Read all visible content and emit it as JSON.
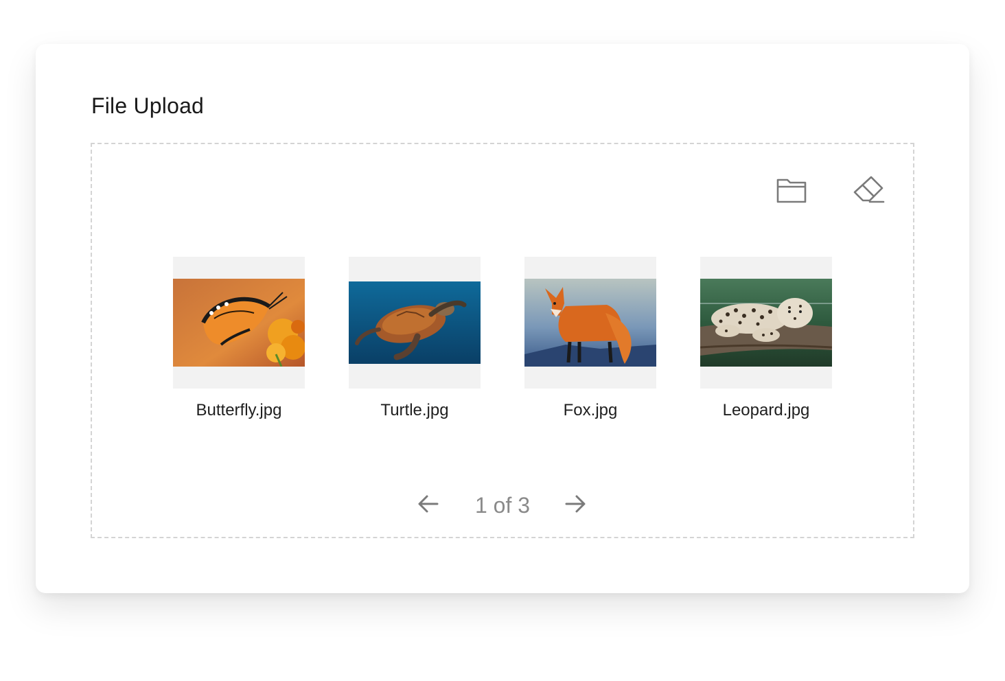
{
  "panel": {
    "title": "File Upload"
  },
  "toolbar": {
    "browse_icon": "folder-open-icon",
    "clear_icon": "eraser-icon"
  },
  "files": [
    {
      "name": "Butterfly.jpg",
      "thumbnail": "butterfly on orange flowers"
    },
    {
      "name": "Turtle.jpg",
      "thumbnail": "sea turtle swimming in blue water"
    },
    {
      "name": "Fox.jpg",
      "thumbnail": "red fox standing on rock"
    },
    {
      "name": "Leopard.jpg",
      "thumbnail": "leopard lying on a log"
    }
  ],
  "pagination": {
    "label": "1 of 3",
    "prev_icon": "arrow-left-icon",
    "next_icon": "arrow-right-icon"
  },
  "colors": {
    "dashed_border": "#d4d4d4",
    "icon": "#7a7a7a",
    "thumb_bg": "#f2f2f2",
    "pager_text": "#8a8a8a"
  }
}
